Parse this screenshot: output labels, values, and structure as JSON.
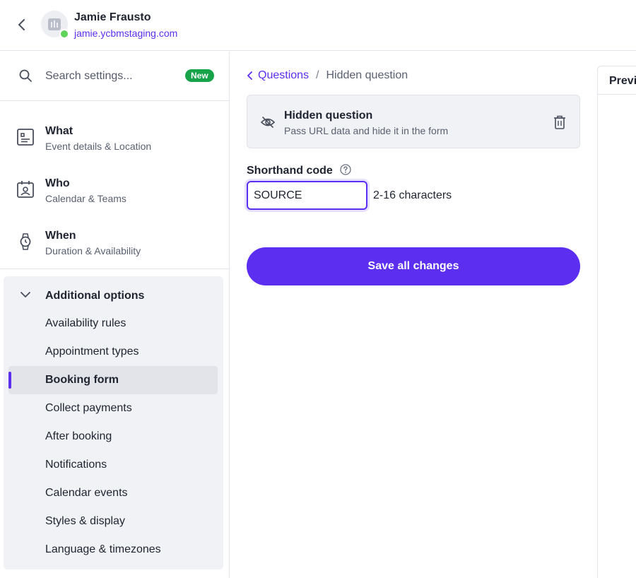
{
  "header": {
    "user_name": "Jamie Frausto",
    "user_domain": "jamie.ycbmstaging.com"
  },
  "sidebar": {
    "search_placeholder": "Search settings...",
    "new_badge": "New",
    "nav": [
      {
        "title": "What",
        "subtitle": "Event details & Location"
      },
      {
        "title": "Who",
        "subtitle": "Calendar & Teams"
      },
      {
        "title": "When",
        "subtitle": "Duration & Availability"
      }
    ],
    "options_title": "Additional options",
    "options": [
      {
        "label": "Availability rules"
      },
      {
        "label": "Appointment types"
      },
      {
        "label": "Booking form",
        "active": true
      },
      {
        "label": "Collect payments"
      },
      {
        "label": "After booking"
      },
      {
        "label": "Notifications"
      },
      {
        "label": "Calendar events"
      },
      {
        "label": "Styles & display"
      },
      {
        "label": "Language & timezones"
      }
    ]
  },
  "main": {
    "breadcrumb_link": "Questions",
    "breadcrumb_sep": "/",
    "breadcrumb_current": "Hidden question",
    "card_title": "Hidden question",
    "card_desc": "Pass URL data and hide it in the form",
    "field_label": "Shorthand code",
    "field_value": "SOURCE",
    "field_hint": "2-16 characters",
    "save_label": "Save all changes"
  },
  "preview": {
    "title": "Previ"
  },
  "colors": {
    "accent": "#5b2ef0",
    "badge_green": "#17a34a",
    "online": "#5fd35a"
  }
}
